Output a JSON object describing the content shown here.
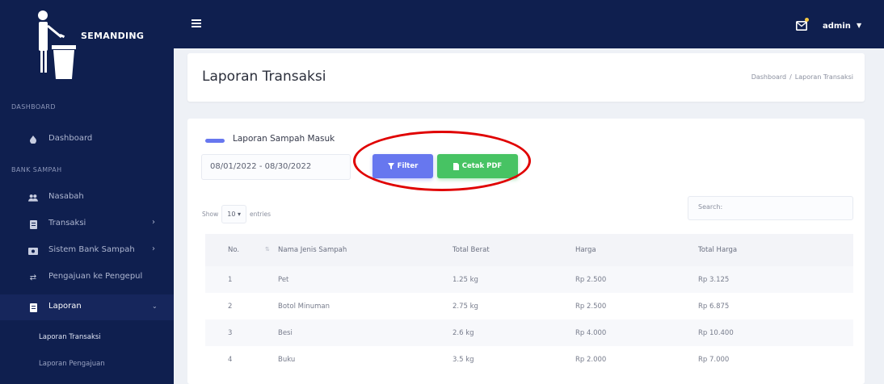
{
  "brand": {
    "name": "SEMANDING"
  },
  "sidebar": {
    "sections": [
      {
        "label": "DASHBOARD"
      },
      {
        "label": "BANK SAMPAH"
      }
    ],
    "items": [
      {
        "label": "Dashboard",
        "icon": "fire-icon",
        "has_children": false
      },
      {
        "label": "Nasabah",
        "icon": "users-icon",
        "has_children": false
      },
      {
        "label": "Transaksi",
        "icon": "receipt-icon",
        "has_children": true
      },
      {
        "label": "Sistem Bank Sampah",
        "icon": "money-icon",
        "has_children": true
      },
      {
        "label": "Pengajuan ke Pengepul",
        "icon": "exchange-icon",
        "has_children": false
      },
      {
        "label": "Laporan",
        "icon": "report-icon",
        "has_children": true
      }
    ],
    "sub_items": [
      {
        "label": "Laporan Transaksi",
        "current": true
      },
      {
        "label": "Laporan Pengajuan",
        "current": false
      }
    ]
  },
  "topbar": {
    "user": "admin"
  },
  "header": {
    "title": "Laporan Transaksi",
    "breadcrumb": [
      "Dashboard",
      "Laporan Transaksi"
    ]
  },
  "card": {
    "title": "Laporan Sampah Masuk",
    "date_range": "08/01/2022 - 08/30/2022",
    "filter_label": "Filter",
    "pdf_label": "Cetak PDF",
    "show_label": "Show",
    "entries_value": "10",
    "entries_label": "entries",
    "search_placeholder": "Search:"
  },
  "table": {
    "columns": [
      "No.",
      "Nama Jenis Sampah",
      "Total Berat",
      "Harga",
      "Total Harga"
    ],
    "rows": [
      [
        "1",
        "Pet",
        "1.25 kg",
        "Rp 2.500",
        "Rp 3.125"
      ],
      [
        "2",
        "Botol Minuman",
        "2.75 kg",
        "Rp 2.500",
        "Rp 6.875"
      ],
      [
        "3",
        "Besi",
        "2.6 kg",
        "Rp 4.000",
        "Rp 10.400"
      ],
      [
        "4",
        "Buku",
        "3.5 kg",
        "Rp 2.000",
        "Rp 7.000"
      ]
    ]
  },
  "colors": {
    "sidebar_bg": "#0f1f4f",
    "primary": "#6777ef",
    "success": "#47c363",
    "highlight": "#e00000"
  }
}
